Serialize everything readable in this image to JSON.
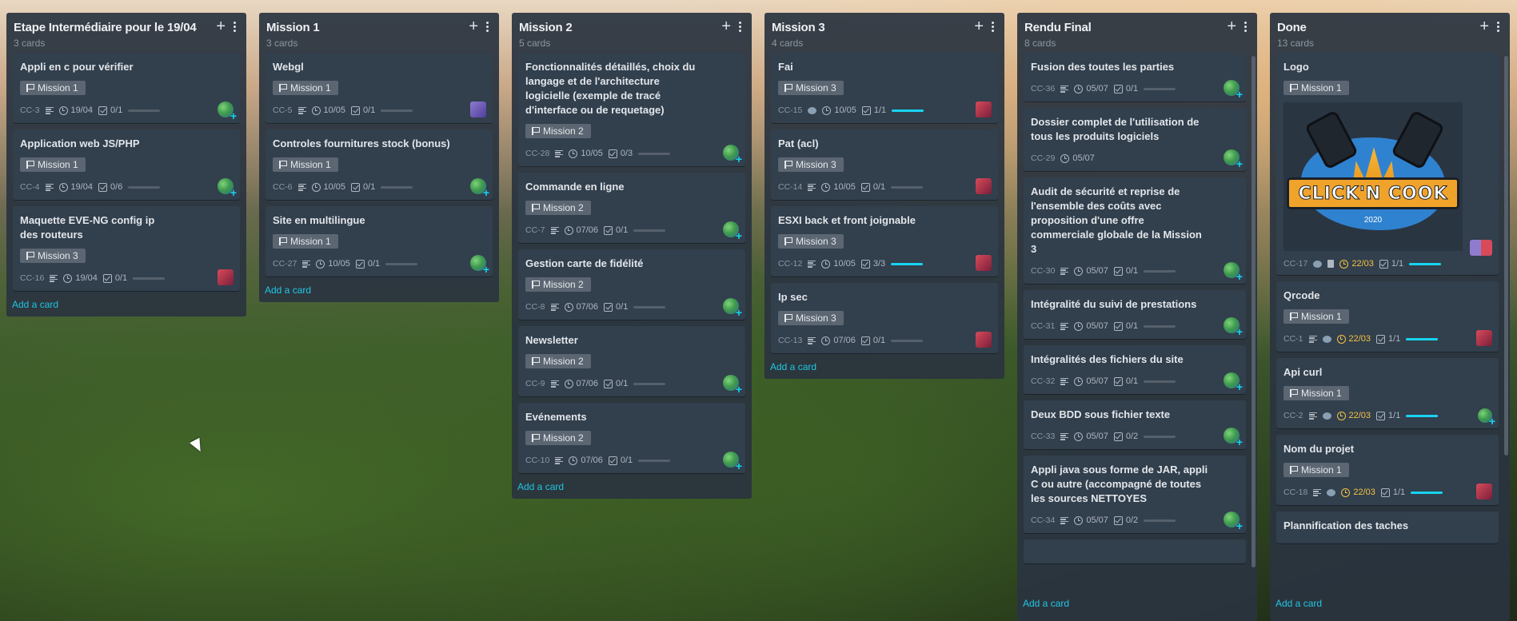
{
  "colors": {
    "accent": "#21c6e3",
    "progress_fill": "#16d4f0",
    "due_date": "#f5c242",
    "list_bg": "#2a343f",
    "card_bg": "#323f4d"
  },
  "add_card_label": "Add a card",
  "lists": [
    {
      "title": "Etape Intermédiaire pour le 19/04",
      "count": "3 cards",
      "cards": [
        {
          "title": "Appli en c pour vérifier",
          "label": "Mission 1",
          "code": "CC-3",
          "date": "19/04",
          "checklist": "0/1",
          "progress": 0,
          "avatar": "globe"
        },
        {
          "title": "Application web JS/PHP",
          "label": "Mission 1",
          "code": "CC-4",
          "date": "19/04",
          "checklist": "0/6",
          "progress": 0,
          "avatar": "globe"
        },
        {
          "title": "Maquette EVE-NG config ip des routeurs",
          "label": "Mission 3",
          "code": "CC-16",
          "date": "19/04",
          "checklist": "0/1",
          "progress": 0,
          "avatar": "robot"
        }
      ]
    },
    {
      "title": "Mission 1",
      "count": "3 cards",
      "cards": [
        {
          "title": "Webgl",
          "label": "Mission 1",
          "code": "CC-5",
          "date": "10/05",
          "checklist": "0/1",
          "progress": 0,
          "avatar": "person"
        },
        {
          "title": "Controles fournitures stock (bonus)",
          "label": "Mission 1",
          "code": "CC-6",
          "date": "10/05",
          "checklist": "0/1",
          "progress": 0,
          "avatar": "globe"
        },
        {
          "title": "Site en multilingue",
          "label": "Mission 1",
          "code": "CC-27",
          "date": "10/05",
          "checklist": "0/1",
          "progress": 0,
          "avatar": "globe"
        }
      ]
    },
    {
      "title": "Mission 2",
      "count": "5 cards",
      "cards": [
        {
          "title": "Fonctionnalités détaillés, choix du langage et de l'architecture logicielle (exemple de tracé d'interface ou de requetage)",
          "label": "Mission 2",
          "code": "CC-28",
          "date": "10/05",
          "checklist": "0/3",
          "progress": 0,
          "avatar": "globe"
        },
        {
          "title": "Commande en ligne",
          "label": "Mission 2",
          "code": "CC-7",
          "date": "07/06",
          "checklist": "0/1",
          "progress": 0,
          "avatar": "globe"
        },
        {
          "title": "Gestion carte de fidélité",
          "label": "Mission 2",
          "code": "CC-8",
          "date": "07/06",
          "checklist": "0/1",
          "progress": 0,
          "avatar": "globe"
        },
        {
          "title": "Newsletter",
          "label": "Mission 2",
          "code": "CC-9",
          "date": "07/06",
          "checklist": "0/1",
          "progress": 0,
          "avatar": "globe"
        },
        {
          "title": "Evénements",
          "label": "Mission 2",
          "code": "CC-10",
          "date": "07/06",
          "checklist": "0/1",
          "progress": 0,
          "avatar": "globe"
        }
      ]
    },
    {
      "title": "Mission 3",
      "count": "4 cards",
      "cards": [
        {
          "title": "Fai",
          "label": "Mission 3",
          "code": "CC-15",
          "comment": true,
          "date": "10/05",
          "checklist": "1/1",
          "progress": 1,
          "avatar": "robot"
        },
        {
          "title": "Pat (acl)",
          "label": "Mission 3",
          "code": "CC-14",
          "date": "10/05",
          "checklist": "0/1",
          "progress": 0,
          "avatar": "robot"
        },
        {
          "title": "ESXI back et front joignable",
          "label": "Mission 3",
          "code": "CC-12",
          "date": "10/05",
          "checklist": "3/3",
          "progress": 1,
          "avatar": "robot"
        },
        {
          "title": "Ip sec",
          "label": "Mission 3",
          "code": "CC-13",
          "date": "07/06",
          "checklist": "0/1",
          "progress": 0,
          "avatar": "robot"
        }
      ]
    },
    {
      "title": "Rendu Final",
      "count": "8 cards",
      "cards": [
        {
          "title": "Fusion des toutes les parties",
          "code": "CC-36",
          "date": "05/07",
          "checklist": "0/1",
          "progress": 0,
          "avatar": "globe"
        },
        {
          "title": "Dossier complet de l'utilisation de tous les produits logiciels",
          "code": "CC-29",
          "date": "05/07",
          "avatar": "globe"
        },
        {
          "title": "Audit de sécurité et reprise de l'ensemble des coûts avec proposition d'une offre commerciale globale de la Mission 3",
          "code": "CC-30",
          "date": "05/07",
          "checklist": "0/1",
          "progress": 0,
          "avatar": "globe"
        },
        {
          "title": "Intégralité du suivi de prestations",
          "code": "CC-31",
          "date": "05/07",
          "checklist": "0/1",
          "progress": 0,
          "avatar": "globe"
        },
        {
          "title": "Intégralités des fichiers du site",
          "code": "CC-32",
          "date": "05/07",
          "checklist": "0/1",
          "progress": 0,
          "avatar": "globe"
        },
        {
          "title": "Deux BDD sous fichier texte",
          "code": "CC-33",
          "date": "05/07",
          "checklist": "0/2",
          "progress": 0,
          "avatar": "globe"
        },
        {
          "title": "Appli java sous forme de JAR, appli C ou autre (accompagné de toutes les sources NETTOYES",
          "code": "CC-34",
          "date": "05/07",
          "checklist": "0/2",
          "progress": 0,
          "avatar": "globe"
        }
      ]
    },
    {
      "title": "Done",
      "count": "13 cards",
      "logo": {
        "text": "CLICK'N COOK",
        "year": "2020"
      },
      "cards": [
        {
          "title": "Logo",
          "label": "Mission 1",
          "code": "CC-17",
          "comment": true,
          "file": true,
          "date": "22/03",
          "due": true,
          "checklist": "1/1",
          "progress": 1,
          "avatar": "pair",
          "has_logo": true
        },
        {
          "title": "Qrcode",
          "label": "Mission 1",
          "code": "CC-1",
          "comment": true,
          "date": "22/03",
          "due": true,
          "checklist": "1/1",
          "progress": 1,
          "avatar": "robot"
        },
        {
          "title": "Api curl",
          "label": "Mission 1",
          "code": "CC-2",
          "comment": true,
          "date": "22/03",
          "due": true,
          "checklist": "1/1",
          "progress": 1,
          "avatar": "globe-plain"
        },
        {
          "title": "Nom du projet",
          "label": "Mission 1",
          "code": "CC-18",
          "comment": true,
          "date": "22/03",
          "due": true,
          "checklist": "1/1",
          "progress": 1,
          "avatar": "robot"
        },
        {
          "title": "Plannification des taches"
        }
      ]
    }
  ]
}
